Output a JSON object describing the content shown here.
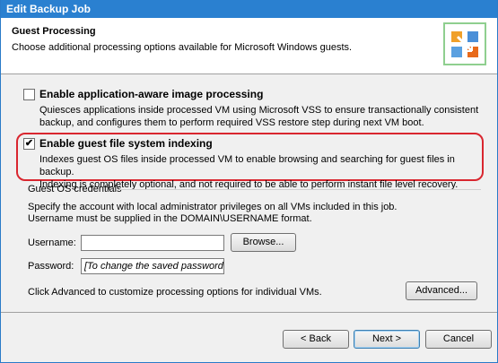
{
  "window": {
    "title": "Edit Backup Job"
  },
  "header": {
    "title": "Guest Processing",
    "subtitle": "Choose additional processing options available for Microsoft Windows guests.",
    "icon": "guest-processing-icon"
  },
  "options": {
    "app_aware": {
      "label": "Enable application-aware image processing",
      "checked": false,
      "description_line1": "Quiesces applications inside processed VM using Microsoft VSS to ensure transactionally consistent",
      "description_line2": "backup, and configures them to perform required VSS restore step during next VM boot."
    },
    "indexing": {
      "label": "Enable guest file system indexing",
      "checked": true,
      "check_glyph": "✔",
      "description_line1": "Indexes guest OS files inside processed VM to enable browsing and searching for guest files in backup.",
      "description_line2": "Indexing is completely optional, and not required to be able to perform instant file level recovery."
    }
  },
  "credentials": {
    "group_label": "Guest OS credentials",
    "help_line1": "Specify the account with local administrator privileges on all VMs included in this job.",
    "help_line2": "Username must be supplied in the DOMAIN\\USERNAME format.",
    "username_label": "Username:",
    "username_value": "",
    "browse_label": "Browse...",
    "password_label": "Password:",
    "password_value": "[To change the saved password,"
  },
  "advanced": {
    "text": "Click Advanced to customize processing options for individual VMs.",
    "button_label": "Advanced..."
  },
  "footer": {
    "back_label": "< Back",
    "next_label": "Next >",
    "cancel_label": "Cancel"
  },
  "colors": {
    "titlebar": "#2a80d0",
    "highlight": "#d9262f"
  }
}
